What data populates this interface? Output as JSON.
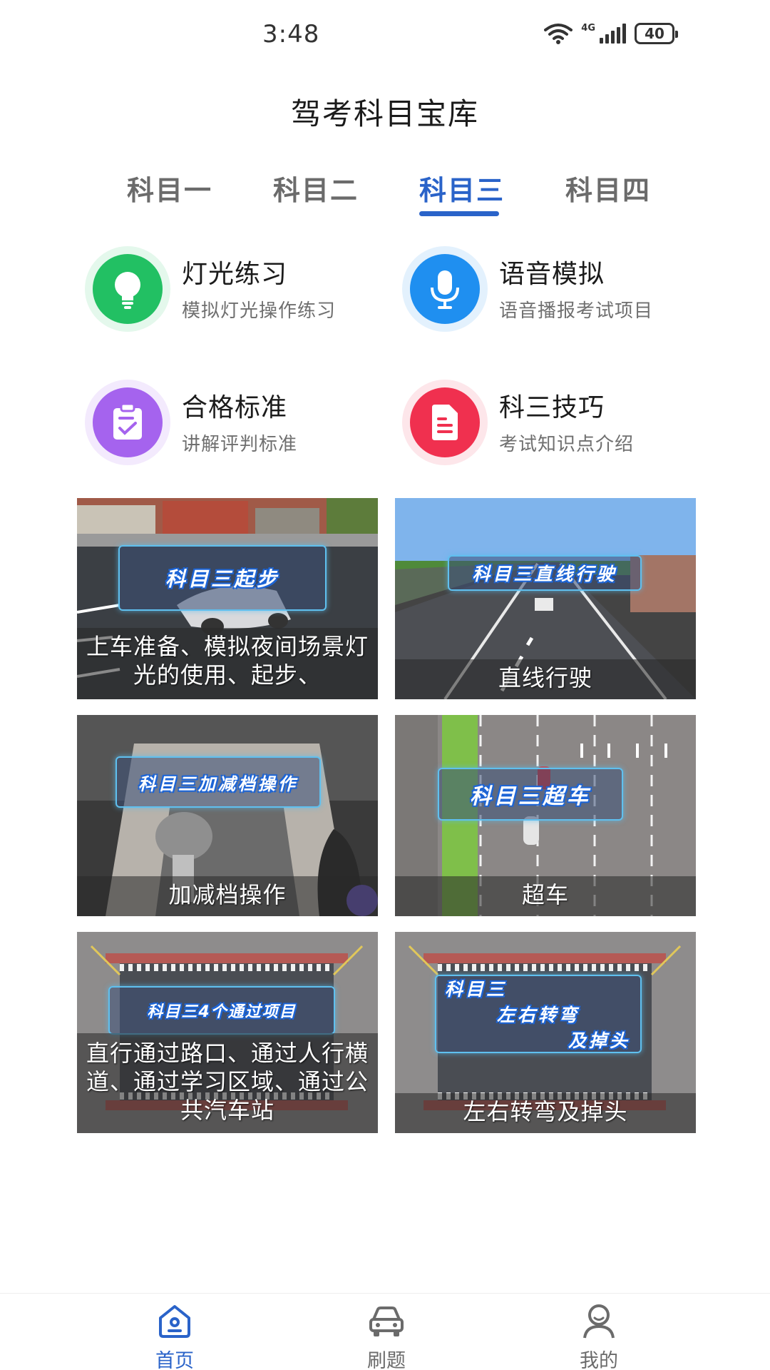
{
  "status_bar": {
    "time": "3:48",
    "network": "4G",
    "battery": "40"
  },
  "app": {
    "title": "驾考科目宝库"
  },
  "tabs": [
    {
      "label": "科目一",
      "active": false
    },
    {
      "label": "科目二",
      "active": false
    },
    {
      "label": "科目三",
      "active": true
    },
    {
      "label": "科目四",
      "active": false
    }
  ],
  "features": [
    {
      "title": "灯光练习",
      "subtitle": "模拟灯光操作练习",
      "icon": "lightbulb-icon",
      "color": "#22c063"
    },
    {
      "title": "语音模拟",
      "subtitle": "语音播报考试项目",
      "icon": "microphone-icon",
      "color": "#1f8ff0"
    },
    {
      "title": "合格标准",
      "subtitle": "讲解评判标准",
      "icon": "clipboard-check-icon",
      "color": "#a563ee"
    },
    {
      "title": "科三技巧",
      "subtitle": "考试知识点介绍",
      "icon": "document-icon",
      "color": "#f0304f"
    }
  ],
  "courses": [
    {
      "badge": "科目三起步",
      "caption": "上车准备、模拟夜间场景灯光的使用、起步、"
    },
    {
      "badge": "科目三直线行驶",
      "caption": "直线行驶"
    },
    {
      "badge": "科目三加减档操作",
      "caption": "加减档操作"
    },
    {
      "badge": "科目三超车",
      "caption": "超车"
    },
    {
      "badge": "科目三4个通过项目",
      "caption": "直行通过路口、通过人行横道、通过学习区域、通过公共汽车站"
    },
    {
      "badge_line1": "科目三",
      "badge_line2": "左右转弯",
      "badge_line3": "及掉头",
      "caption": "左右转弯及掉头"
    }
  ],
  "nav": [
    {
      "label": "首页",
      "icon": "home-icon",
      "active": true
    },
    {
      "label": "刷题",
      "icon": "car-icon",
      "active": false
    },
    {
      "label": "我的",
      "icon": "user-icon",
      "active": false
    }
  ],
  "colors": {
    "accent": "#2a63c9"
  }
}
